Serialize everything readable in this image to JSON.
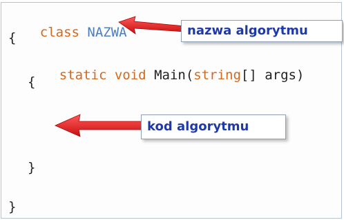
{
  "code": {
    "kw_class": "class",
    "class_name": "NAZWA",
    "brace_open_outer": "{",
    "kw_static": "static",
    "kw_void": "void",
    "method_name": "Main(",
    "kw_string": "string",
    "params": "[] args)",
    "brace_open_inner": "{",
    "brace_close_inner": "}",
    "brace_close_outer": "}"
  },
  "callouts": {
    "name_label": "nazwa algorytmu",
    "code_label": "kod algorytmu"
  },
  "colors": {
    "keyword": "#d2691e",
    "type": "#4a7fbf",
    "label_text": "#1f3aa8",
    "arrow": "#e01a1a"
  }
}
